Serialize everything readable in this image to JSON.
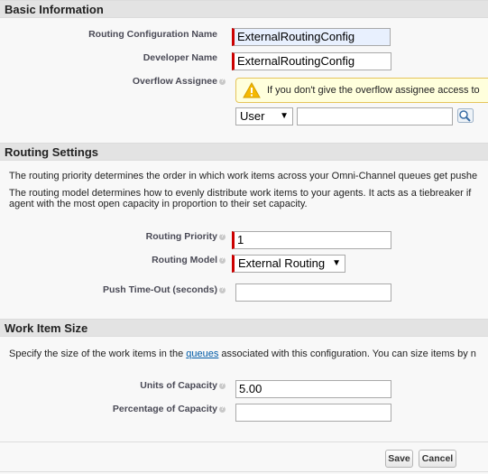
{
  "basic": {
    "header": "Basic Information",
    "routing_config_name_label": "Routing Configuration Name",
    "routing_config_name_value": "ExternalRoutingConfig",
    "developer_name_label": "Developer Name",
    "developer_name_value": "ExternalRoutingConfig",
    "overflow_label": "Overflow Assignee",
    "overflow_warning": "If you don't give the overflow assignee access to",
    "assignee_type": "User",
    "assignee_value": ""
  },
  "routing": {
    "header": "Routing Settings",
    "desc1": "The routing priority determines the order in which work items across your Omni-Channel queues get pushe",
    "desc2": "The routing model determines how to evenly distribute work items to your agents. It acts as a tiebreaker if",
    "desc3": "agent with the most open capacity in proportion to their set capacity.",
    "priority_label": "Routing Priority",
    "priority_value": "1",
    "model_label": "Routing Model",
    "model_value": "External Routing",
    "push_timeout_label": "Push Time-Out (seconds)",
    "push_timeout_value": ""
  },
  "work_item": {
    "header": "Work Item Size",
    "desc_prefix": "Specify the size of the work items in the ",
    "desc_link": "queues",
    "desc_suffix": " associated with this configuration. You can size items by n",
    "units_label": "Units of Capacity",
    "units_value": "5.00",
    "percentage_label": "Percentage of Capacity",
    "percentage_value": ""
  },
  "buttons": {
    "save": "Save",
    "cancel": "Cancel"
  },
  "icons": {
    "help": "help-icon",
    "warning": "warning-icon",
    "lookup": "lookup-icon",
    "dropdown": "chevron-down-icon"
  }
}
